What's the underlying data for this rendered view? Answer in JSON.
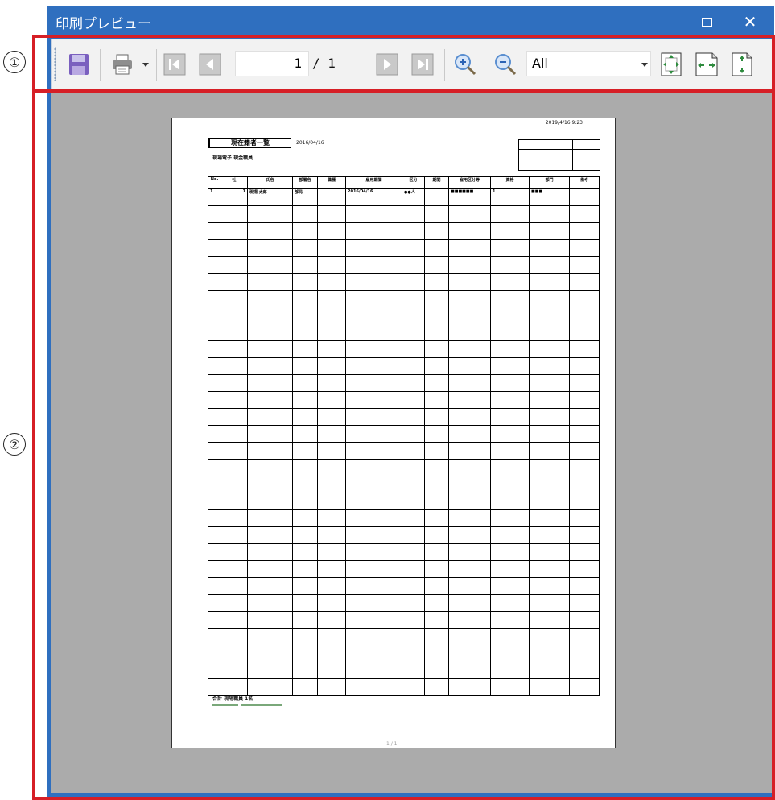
{
  "window": {
    "title": "印刷プレビュー",
    "maximize_icon": "maximize-icon",
    "close_icon": "close-icon"
  },
  "callouts": [
    "①",
    "②"
  ],
  "toolbar": {
    "save_icon": "save-icon",
    "print_icon": "print-icon",
    "first_page_icon": "first-page-icon",
    "prev_page_icon": "prev-page-icon",
    "next_page_icon": "next-page-icon",
    "last_page_icon": "last-page-icon",
    "zoom_in_icon": "zoom-in-icon",
    "zoom_out_icon": "zoom-out-icon",
    "current_page": "1",
    "page_total": "/ 1",
    "zoom_value": "All",
    "fit_page_icon": "fit-page-icon",
    "fit_width_icon": "fit-width-icon",
    "fit_height_icon": "fit-height-icon"
  },
  "document": {
    "header_datetime": "2019/4/16 9:23",
    "report_title": "現在籍者一覧",
    "report_date": "2016/04/16",
    "subtitle": "現場電子 現金職員",
    "columns": [
      "No.",
      "社",
      "氏名",
      "部署名",
      "職種",
      "雇用期間",
      "区分",
      "期間",
      "雇用区分等",
      "資格",
      "部門",
      "備考"
    ],
    "rows": [
      [
        "1",
        "1",
        "現場 太郎",
        "部局",
        "",
        "2016/04/16",
        "●●人",
        "",
        "■■■■■■",
        "1",
        "■■■",
        ""
      ]
    ],
    "footer_label": "合計 現場職員 1名",
    "page_footer": "1 / 1"
  }
}
